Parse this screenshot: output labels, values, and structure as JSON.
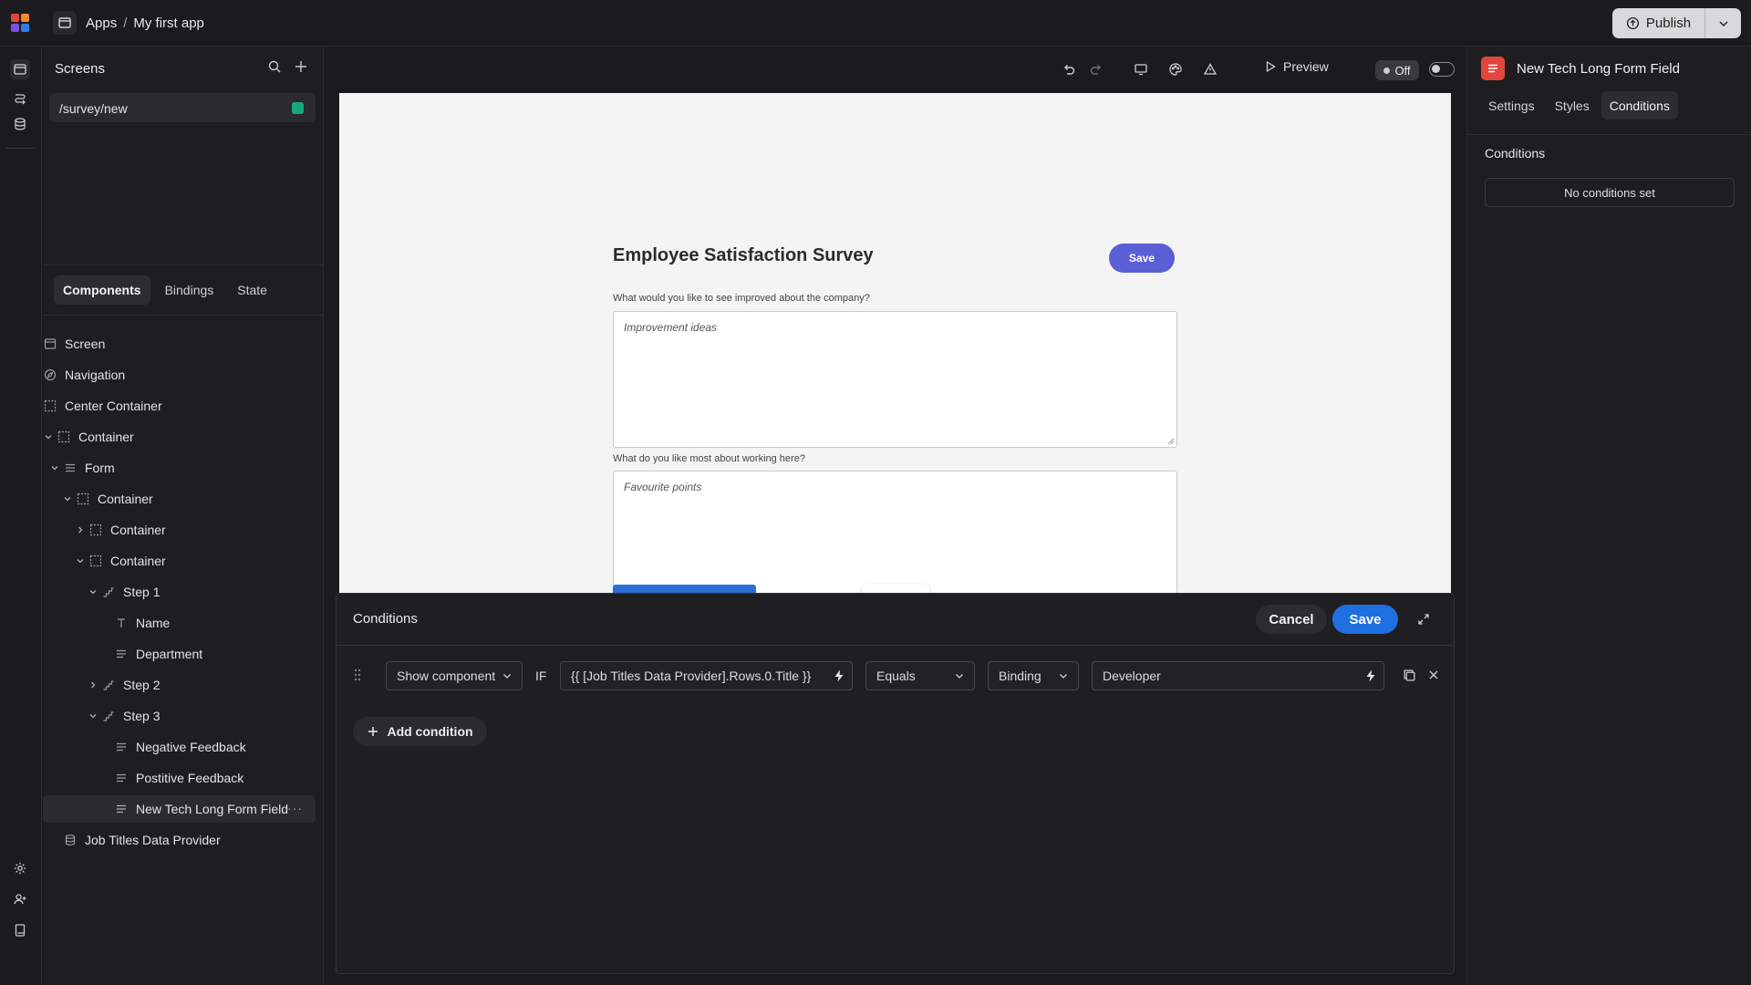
{
  "colors": {
    "accent_blue": "#1f6fe0",
    "survey_save": "#5b5fd6",
    "status_green": "#1aa77b",
    "component_badge": "#e2453c"
  },
  "topbar": {
    "breadcrumb": [
      "Apps",
      "/",
      "My first app"
    ],
    "publish_label": "Publish"
  },
  "screens": {
    "title": "Screens",
    "items": [
      {
        "label": "/survey/new"
      }
    ]
  },
  "left_tabs": [
    "Components",
    "Bindings",
    "State"
  ],
  "tree": [
    {
      "label": "Screen",
      "icon": "screen-icon"
    },
    {
      "label": "Navigation",
      "icon": "navigation-icon"
    },
    {
      "label": "Center Container",
      "icon": "container-icon"
    },
    {
      "label": "Container",
      "icon": "container-icon"
    },
    {
      "label": "Form",
      "icon": "form-icon"
    },
    {
      "label": "Container",
      "icon": "container-icon"
    },
    {
      "label": "Container",
      "icon": "container-icon"
    },
    {
      "label": "Container",
      "icon": "container-icon"
    },
    {
      "label": "Step 1",
      "icon": "step-icon"
    },
    {
      "label": "Name",
      "icon": "text-field-icon"
    },
    {
      "label": "Department",
      "icon": "long-text-icon"
    },
    {
      "label": "Step 2",
      "icon": "step-icon"
    },
    {
      "label": "Step 3",
      "icon": "step-icon"
    },
    {
      "label": "Negative Feedback",
      "icon": "long-text-icon"
    },
    {
      "label": "Postitive Feedback",
      "icon": "long-text-icon"
    },
    {
      "label": "New Tech Long Form Field",
      "icon": "long-text-icon"
    },
    {
      "label": "Job Titles Data Provider",
      "icon": "database-icon"
    }
  ],
  "toolbar": {
    "preview_label": "Preview",
    "state_label": "Off"
  },
  "survey": {
    "title": "Employee Satisfaction Survey",
    "save_label": "Save",
    "q1_label": "What would you like to see improved about the company?",
    "q1_placeholder": "Improvement ideas",
    "q2_label": "What do you like most about working here?",
    "q2_placeholder": "Favourite points"
  },
  "conditions_editor": {
    "title": "Conditions",
    "cancel_label": "Cancel",
    "save_label": "Save",
    "action": "Show component",
    "if_label": "IF",
    "left_operand": "{{ [Job Titles Data Provider].Rows.0.Title }}",
    "operator": "Equals",
    "right_type": "Binding",
    "right_value": "Developer",
    "add_label": "Add condition"
  },
  "right_panel": {
    "title": "New Tech Long Form Field",
    "tabs": [
      "Settings",
      "Styles",
      "Conditions"
    ],
    "section_title": "Conditions",
    "empty_label": "No conditions set"
  }
}
